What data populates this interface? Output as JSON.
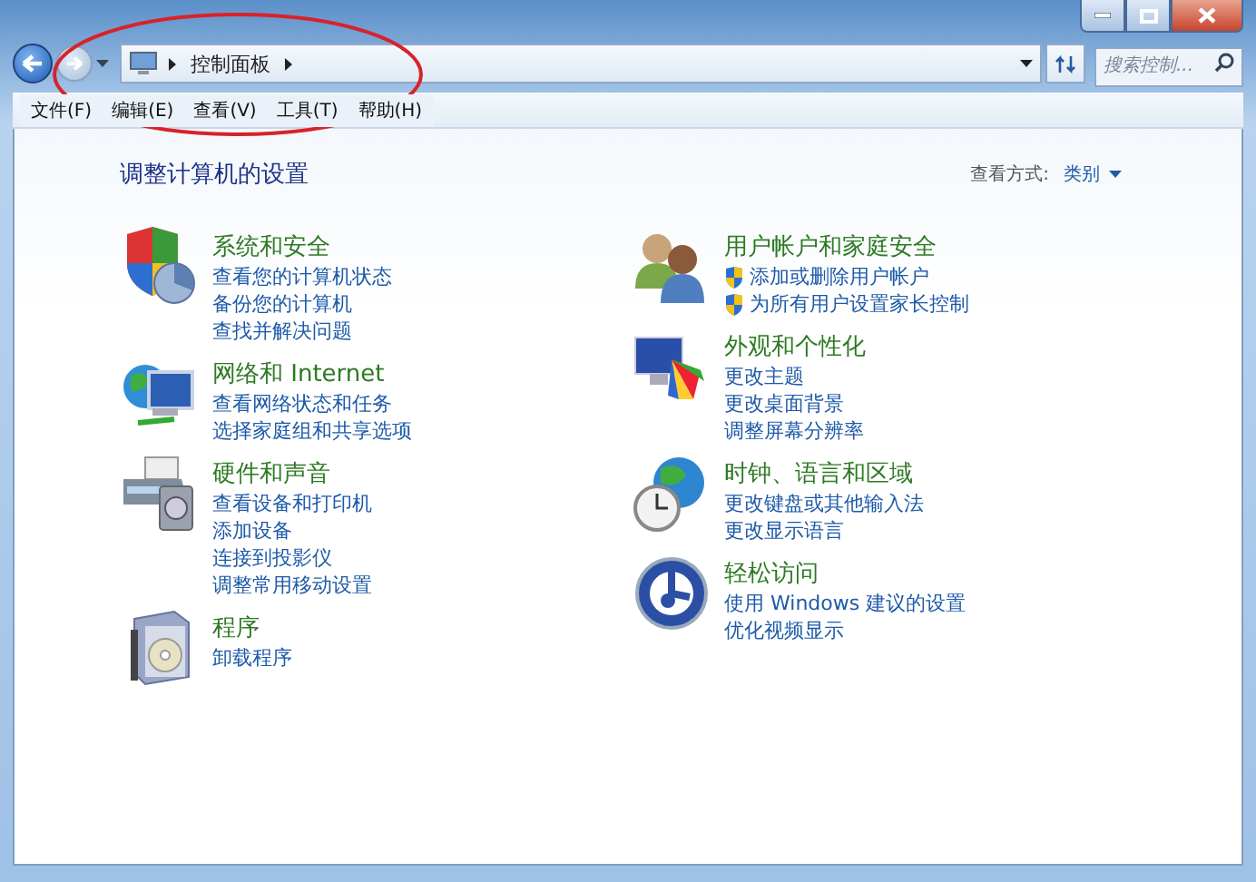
{
  "address": {
    "breadcrumb": [
      "控制面板"
    ]
  },
  "search": {
    "placeholder": "搜索控制..."
  },
  "menu": [
    "文件(F)",
    "编辑(E)",
    "查看(V)",
    "工具(T)",
    "帮助(H)"
  ],
  "page": {
    "heading": "调整计算机的设置",
    "view_by": {
      "label": "查看方式:",
      "value": "类别"
    }
  },
  "columns": [
    [
      {
        "title": "系统和安全",
        "links": [
          {
            "text": "查看您的计算机状态",
            "shield": false
          },
          {
            "text": "备份您的计算机",
            "shield": false
          },
          {
            "text": "查找并解决问题",
            "shield": false
          }
        ]
      },
      {
        "title": "网络和 Internet",
        "links": [
          {
            "text": "查看网络状态和任务",
            "shield": false
          },
          {
            "text": "选择家庭组和共享选项",
            "shield": false
          }
        ]
      },
      {
        "title": "硬件和声音",
        "links": [
          {
            "text": "查看设备和打印机",
            "shield": false
          },
          {
            "text": "添加设备",
            "shield": false
          },
          {
            "text": "连接到投影仪",
            "shield": false
          },
          {
            "text": "调整常用移动设置",
            "shield": false
          }
        ]
      },
      {
        "title": "程序",
        "links": [
          {
            "text": "卸载程序",
            "shield": false
          }
        ]
      }
    ],
    [
      {
        "title": "用户帐户和家庭安全",
        "links": [
          {
            "text": "添加或删除用户帐户",
            "shield": true
          },
          {
            "text": "为所有用户设置家长控制",
            "shield": true
          }
        ]
      },
      {
        "title": "外观和个性化",
        "links": [
          {
            "text": "更改主题",
            "shield": false
          },
          {
            "text": "更改桌面背景",
            "shield": false
          },
          {
            "text": "调整屏幕分辨率",
            "shield": false
          }
        ]
      },
      {
        "title": "时钟、语言和区域",
        "links": [
          {
            "text": "更改键盘或其他输入法",
            "shield": false
          },
          {
            "text": "更改显示语言",
            "shield": false
          }
        ]
      },
      {
        "title": "轻松访问",
        "links": [
          {
            "text": "使用 Windows 建议的设置",
            "shield": false
          },
          {
            "text": "优化视频显示",
            "shield": false
          }
        ]
      }
    ]
  ],
  "highlight_ellipse": true
}
